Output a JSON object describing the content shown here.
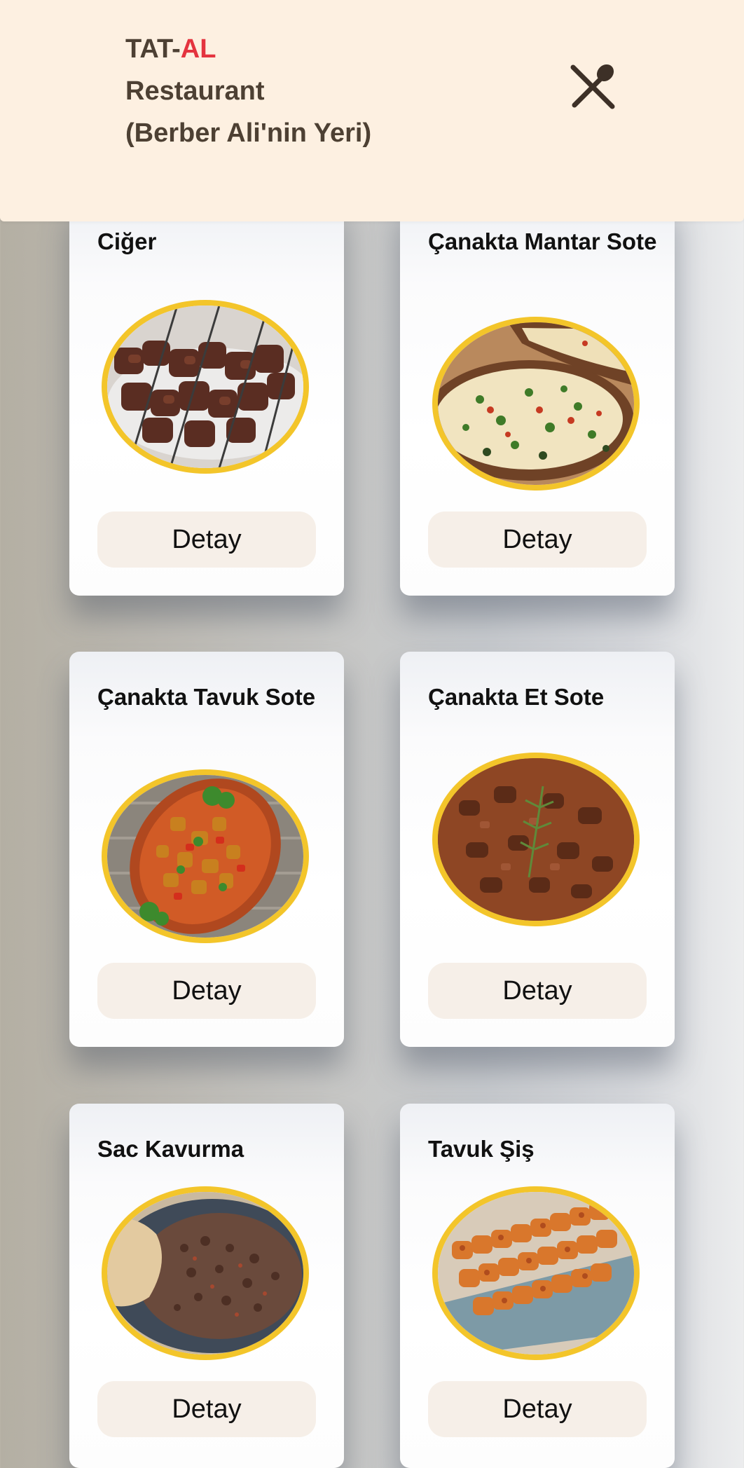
{
  "header": {
    "brand_prefix": "TAT-",
    "brand_accent": "AL",
    "brand_line2": "Restaurant",
    "brand_line3": "(Berber Ali'nin Yeri)",
    "menu_icon": "utensils-icon",
    "accent_color": "#e4343f",
    "background_color": "#fdf0e1"
  },
  "detail_label": "Detay",
  "menu": {
    "items": [
      {
        "name": "Ciğer",
        "image": "liver-skewers-image"
      },
      {
        "name": "Çanakta Mantar Sote",
        "image": "mushroom-saute-image"
      },
      {
        "name": "Çanakta Tavuk Sote",
        "image": "chicken-saute-image"
      },
      {
        "name": "Çanakta Et Sote",
        "image": "meat-saute-image"
      },
      {
        "name": "Sac Kavurma",
        "image": "sac-kavurma-image"
      },
      {
        "name": "Tavuk Şiş",
        "image": "chicken-skewers-image"
      }
    ]
  },
  "colors": {
    "image_ring": "#f3c52a",
    "button_bg": "#f6efe8"
  }
}
